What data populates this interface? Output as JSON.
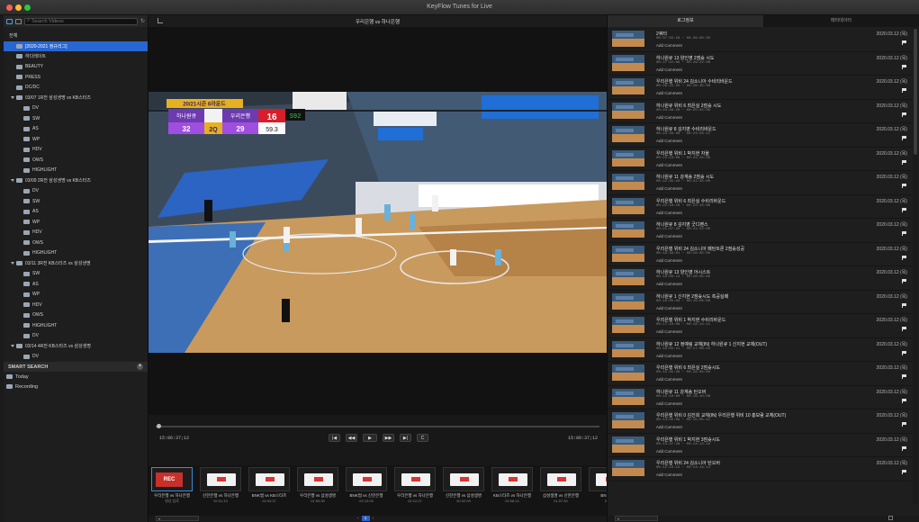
{
  "window": {
    "title": "KeyFlow Tunes for Live"
  },
  "sidebar": {
    "search_placeholder": "Search Videos",
    "root": "전체",
    "tree": [
      {
        "label": "[2020-2021 정규리그]",
        "level": 1,
        "kind": "folder",
        "selected": true
      },
      {
        "label": "하다레이트",
        "level": 1,
        "kind": "folder"
      },
      {
        "label": "BEAUTY",
        "level": 1,
        "kind": "folder"
      },
      {
        "label": "PRESS",
        "level": 1,
        "kind": "folder"
      },
      {
        "label": "DC/DC",
        "level": 1,
        "kind": "folder"
      },
      {
        "label": "03/07 1R전 삼성생명 vs KB스타즈",
        "level": 0,
        "kind": "group"
      },
      {
        "label": "DV",
        "level": 2,
        "kind": "folder"
      },
      {
        "label": "SW",
        "level": 2,
        "kind": "folder"
      },
      {
        "label": "AS",
        "level": 2,
        "kind": "folder"
      },
      {
        "label": "WP",
        "level": 2,
        "kind": "folder"
      },
      {
        "label": "HDV",
        "level": 2,
        "kind": "folder"
      },
      {
        "label": "OWS",
        "level": 2,
        "kind": "folder"
      },
      {
        "label": "HIGHLIGHT",
        "level": 2,
        "kind": "folder"
      },
      {
        "label": "03/09 2R전 삼성생명 vs KB스타즈",
        "level": 0,
        "kind": "group"
      },
      {
        "label": "DV",
        "level": 2,
        "kind": "folder"
      },
      {
        "label": "SW",
        "level": 2,
        "kind": "folder"
      },
      {
        "label": "AS",
        "level": 2,
        "kind": "folder"
      },
      {
        "label": "WP",
        "level": 2,
        "kind": "folder"
      },
      {
        "label": "HDV",
        "level": 2,
        "kind": "folder"
      },
      {
        "label": "OWS",
        "level": 2,
        "kind": "folder"
      },
      {
        "label": "HIGHLIGHT",
        "level": 2,
        "kind": "folder"
      },
      {
        "label": "03/11 3R전 KB스타즈 vs 삼성생명",
        "level": 0,
        "kind": "group"
      },
      {
        "label": "SW",
        "level": 2,
        "kind": "folder"
      },
      {
        "label": "AS",
        "level": 2,
        "kind": "folder"
      },
      {
        "label": "WP",
        "level": 2,
        "kind": "folder"
      },
      {
        "label": "HDV",
        "level": 2,
        "kind": "folder"
      },
      {
        "label": "OWS",
        "level": 2,
        "kind": "folder"
      },
      {
        "label": "HIGHLIGHT",
        "level": 2,
        "kind": "folder"
      },
      {
        "label": "DV",
        "level": 2,
        "kind": "folder"
      },
      {
        "label": "03/14 4R전 KB스타즈 vs 삼성생명",
        "level": 0,
        "kind": "group"
      },
      {
        "label": "DV",
        "level": 2,
        "kind": "folder"
      }
    ],
    "smart_search": "SMART SEARCH",
    "smart_items": [
      "Today",
      "Recording"
    ]
  },
  "center": {
    "title": "우리은행 vs 하나은행",
    "timecode_left": "15:06:37;12",
    "timecode_right": "15:06:37;12",
    "page": "1",
    "clips": [
      {
        "name": "우리은행 vs 하나은행",
        "sub": "영상 업로",
        "kind": "rec"
      },
      {
        "name": "신한은행 vs 하나은행",
        "sub": "02:01:13",
        "kind": "game"
      },
      {
        "name": "BNK썸 vs KB스타즈",
        "sub": "02:03:37",
        "kind": "game"
      },
      {
        "name": "우리은행 vs 삼성생명",
        "sub": "01:50:39",
        "kind": "game"
      },
      {
        "name": "BNK썸 vs 신한은행",
        "sub": "02:10:03",
        "kind": "game"
      },
      {
        "name": "우리은행 vs 하나은행",
        "sub": "02:12:27",
        "kind": "game"
      },
      {
        "name": "신한은행 vs 삼성생명",
        "sub": "02:02:09",
        "kind": "game"
      },
      {
        "name": "KB스타즈 vs 하나은행",
        "sub": "02:08:14",
        "kind": "game"
      },
      {
        "name": "삼성생명 vs 신한은행",
        "sub": "01:57:50",
        "kind": "game"
      },
      {
        "name": "BNK썸 vs",
        "sub": "02:01",
        "kind": "game"
      }
    ],
    "scoreboard": {
      "period_banner": "20/21시즌 6라운드",
      "home": "하나원큐",
      "home_score": "32",
      "quarter": "2Q",
      "away": "우리은행",
      "away_score": "29",
      "fouls": "16",
      "clock": "59.3",
      "shot_clock": "S92"
    }
  },
  "right": {
    "tabs": [
      "로그정보",
      "메타데이터"
    ],
    "events": [
      {
        "title": "2쿼터",
        "time": "00:37:55:18 ~ 00:39:09:20",
        "date": "2020.03.12 (목)"
      },
      {
        "title": "하나원큐 13 양인영 2점슛 시도",
        "time": "00:27:22:06 ~ 00:29:22:08",
        "date": "2020.03.12 (목)"
      },
      {
        "title": "우리은행 위비 24 김소니아 수비리바운드",
        "time": "00:26:25:20 ~ 00:26:35:08",
        "date": "2020.03.12 (목)"
      },
      {
        "title": "하나원큐 위비 6 최은실 2점슛 시도",
        "time": "00:24:46:20 ~ 00:25:02:06",
        "date": "2020.03.12 (목)"
      },
      {
        "title": "하나원큐 8 김지영 수비리바운드",
        "time": "00:23:39:06 ~ 00:23:56:11",
        "date": "2020.03.12 (목)"
      },
      {
        "title": "우리은행 위비 1 박지현 자울",
        "time": "00:23:19:06 ~ 00:23:15:08",
        "date": "2020.03.12 (목)"
      },
      {
        "title": "하나원큐 11 강계송 2점슛 시도",
        "time": "00:22:35:20 ~ 00:22:45:00",
        "date": "2020.03.12 (목)"
      },
      {
        "title": "우리은행 위비 6 최은실 수비리바운드",
        "time": "00:22:10:10 ~ 00:22:15:00",
        "date": "2020.03.12 (목)"
      },
      {
        "title": "하나원큐 8 김지영 굿디펜스",
        "time": "00:21:07:20 ~ 00:21:22:00",
        "date": "2020.03.12 (목)"
      },
      {
        "title": "우리은행 위비 24 김소니아 패턴트론 2점슛성공",
        "time": "00:19:39:01 ~ 00:20:05:00",
        "date": "2020.03.12 (목)"
      },
      {
        "title": "하나원큐 13 양인영 어시스트",
        "time": "00:19:08:13 ~ 00:20:05:00",
        "date": "2020.03.12 (목)"
      },
      {
        "title": "하나원큐 1 신지현 2점슛시도 측공실패",
        "time": "00:18:05:04 ~ 00:19:06:08",
        "date": "2020.03.12 (목)"
      },
      {
        "title": "우리은행 위비 1 박지현 수비리바운드",
        "time": "00:17:10:08 ~ 00:18:14:11",
        "date": "2020.03.12 (목)"
      },
      {
        "title": "하나원큐 12 정예림 교체(IN) 하나원큐 1 신지현 교체(OUT)",
        "time": "00:16:05:21 ~ 00:17:06:23",
        "date": "2020.03.12 (목)"
      },
      {
        "title": "우리은행 위비 6 최은실 2점슛시도",
        "time": "00:15:35:20 ~ 00:16:05:00",
        "date": "2020.03.12 (목)"
      },
      {
        "title": "하나원큐 11 강계송 턴오버",
        "time": "00:15:10:00 ~ 00:16:10:08",
        "date": "2020.03.12 (목)"
      },
      {
        "title": "우리은행 위비 0 김진희 교체(IN) 우리은행 위비 10 홍보람 교체(OUT)",
        "time": "00:14:05:09 ~ 00:15:05:11",
        "date": "2020.03.12 (목)"
      },
      {
        "title": "우리은행 위비 1 박지현 3점슛시도",
        "time": "00:13:37:18 ~ 00:14:12:18",
        "date": "2020.03.12 (목)"
      },
      {
        "title": "우리은행 위비 24 김소니아 턴오버",
        "time": "00:12:15:12 ~ 00:13:13:14",
        "date": "2020.03.12 (목)"
      }
    ],
    "add_comment": "Add Comment"
  }
}
